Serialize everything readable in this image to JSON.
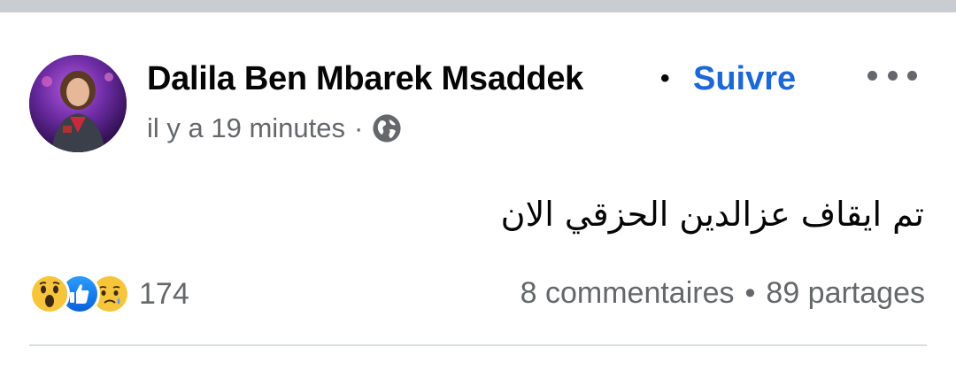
{
  "post": {
    "author": "Dalila Ben Mbarek Msaddek",
    "separator": "•",
    "follow_label": "Suivre",
    "time": "il y a 19 minutes",
    "meta_separator": "·",
    "privacy_icon": "globe-icon",
    "message": "تم ايقاف عزالدين الحزقي الان"
  },
  "engagement": {
    "reactions": [
      "wow-icon",
      "like-icon",
      "sad-icon"
    ],
    "reaction_count": "174",
    "comments": "8 commentaires",
    "bullet": "•",
    "shares": "89 partages"
  },
  "colors": {
    "accent": "#1b68d6",
    "secondary_text": "#65676b",
    "top_strip": "#c9ccd1"
  }
}
